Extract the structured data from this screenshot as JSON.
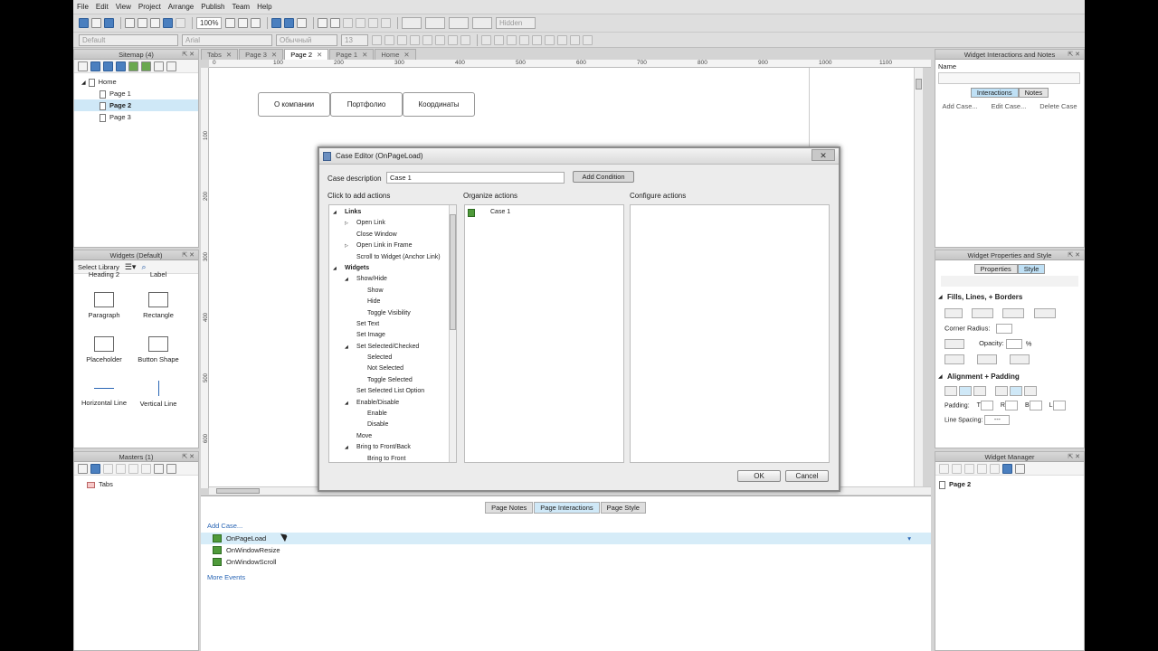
{
  "menu": [
    "File",
    "Edit",
    "View",
    "Project",
    "Arrange",
    "Publish",
    "Team",
    "Help"
  ],
  "toolbar": {
    "zoom": "100%",
    "hidden_label": "Hidden",
    "style_default": "Default",
    "font": "Arial",
    "font_style": "Обычный",
    "font_size": "13"
  },
  "sitemap": {
    "title": "Sitemap (4)",
    "items": [
      {
        "label": "Home"
      },
      {
        "label": "Page 1"
      },
      {
        "label": "Page 2"
      },
      {
        "label": "Page 3"
      }
    ]
  },
  "widgets": {
    "title": "Widgets (Default)",
    "select_label": "Select Library",
    "items": [
      "Heading 2",
      "Label",
      "Paragraph",
      "Rectangle",
      "Placeholder",
      "Button Shape",
      "Horizontal Line",
      "Vertical Line"
    ]
  },
  "masters": {
    "title": "Masters (1)",
    "items": [
      "Tabs"
    ]
  },
  "tabs": [
    {
      "label": "Tabs"
    },
    {
      "label": "Page 3"
    },
    {
      "label": "Page 2"
    },
    {
      "label": "Page 1"
    },
    {
      "label": "Home"
    }
  ],
  "ruler": {
    "h": [
      "0",
      "100",
      "200",
      "300",
      "400",
      "500",
      "600",
      "700",
      "800",
      "900",
      "1000",
      "1100"
    ],
    "v": [
      "100",
      "200",
      "300",
      "400",
      "500",
      "600"
    ]
  },
  "canvas": {
    "nav": [
      "О компании",
      "Портфолио",
      "Координаты"
    ]
  },
  "dialog": {
    "title": "Case Editor (OnPageLoad)",
    "close": "✕",
    "case_desc_label": "Case description",
    "case_desc_value": "Case 1",
    "add_condition": "Add Condition",
    "col1": "Click to add actions",
    "col2": "Organize actions",
    "col3": "Configure actions",
    "actions": [
      {
        "label": "Links",
        "level": 0,
        "bold": true,
        "arrow": "◢"
      },
      {
        "label": "Open Link",
        "level": 1,
        "arrow": "▷"
      },
      {
        "label": "Close Window",
        "level": 1,
        "arrow": ""
      },
      {
        "label": "Open Link in Frame",
        "level": 1,
        "arrow": "▷"
      },
      {
        "label": "Scroll to Widget (Anchor Link)",
        "level": 1,
        "arrow": ""
      },
      {
        "label": "Widgets",
        "level": 0,
        "bold": true,
        "arrow": "◢"
      },
      {
        "label": "Show/Hide",
        "level": 1,
        "arrow": "◢"
      },
      {
        "label": "Show",
        "level": 2,
        "arrow": ""
      },
      {
        "label": "Hide",
        "level": 2,
        "arrow": ""
      },
      {
        "label": "Toggle Visibility",
        "level": 2,
        "arrow": ""
      },
      {
        "label": "Set Text",
        "level": 1,
        "arrow": ""
      },
      {
        "label": "Set Image",
        "level": 1,
        "arrow": ""
      },
      {
        "label": "Set Selected/Checked",
        "level": 1,
        "arrow": "◢"
      },
      {
        "label": "Selected",
        "level": 2,
        "arrow": ""
      },
      {
        "label": "Not Selected",
        "level": 2,
        "arrow": ""
      },
      {
        "label": "Toggle Selected",
        "level": 2,
        "arrow": ""
      },
      {
        "label": "Set Selected List Option",
        "level": 1,
        "arrow": ""
      },
      {
        "label": "Enable/Disable",
        "level": 1,
        "arrow": "◢"
      },
      {
        "label": "Enable",
        "level": 2,
        "arrow": ""
      },
      {
        "label": "Disable",
        "level": 2,
        "arrow": ""
      },
      {
        "label": "Move",
        "level": 1,
        "arrow": ""
      },
      {
        "label": "Bring to Front/Back",
        "level": 1,
        "arrow": "◢"
      },
      {
        "label": "Bring to Front",
        "level": 2,
        "arrow": ""
      }
    ],
    "organize": [
      "Case 1"
    ],
    "ok": "OK",
    "cancel": "Cancel"
  },
  "bottom": {
    "tabs": [
      "Page Notes",
      "Page Interactions",
      "Page Style"
    ],
    "add_case": "Add Case...",
    "events": [
      "OnPageLoad",
      "OnWindowResize",
      "OnWindowScroll"
    ],
    "more": "More Events"
  },
  "interactions": {
    "title": "Widget Interactions and Notes",
    "name_label": "Name",
    "tabs": [
      "Interactions",
      "Notes"
    ],
    "actions": [
      "Add Case...",
      "Edit Case...",
      "Delete Case"
    ]
  },
  "props": {
    "title": "Widget Properties and Style",
    "tabs": [
      "Properties",
      "Style"
    ],
    "fills": "Fills, Lines, + Borders",
    "corner": "Corner Radius:",
    "opacity": "Opacity:",
    "percent": "%",
    "align": "Alignment + Padding",
    "padding": "Padding:",
    "pad_labels": [
      "T",
      "R",
      "B",
      "L"
    ],
    "spacing": "Line Spacing:",
    "spacing_value": "---"
  },
  "manager": {
    "title": "Widget Manager",
    "items": [
      "Page 2"
    ]
  }
}
